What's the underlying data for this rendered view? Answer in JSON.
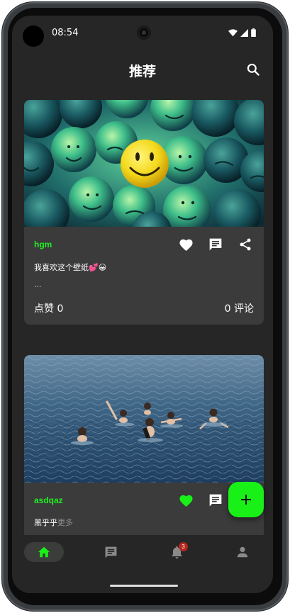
{
  "status_bar": {
    "time": "08:54"
  },
  "app_bar": {
    "title": "推荐",
    "search_icon": "search-icon"
  },
  "posts": [
    {
      "author": "hgm",
      "text": "我喜欢这个壁纸💕😀",
      "ellipsis": "...",
      "likes_label": "点赞 0",
      "comments_label": "0 评论",
      "liked": false,
      "image": "green smiley balls with one yellow smiley"
    },
    {
      "author": "asdqaz",
      "text": "黑乎乎",
      "more": "更多",
      "liked": true,
      "image": "people swimming in the sea"
    }
  ],
  "fab": {
    "icon": "plus-icon"
  },
  "bottom_nav": {
    "items": [
      {
        "icon": "home-icon",
        "active": true
      },
      {
        "icon": "chat-icon",
        "active": false
      },
      {
        "icon": "bell-icon",
        "active": false,
        "badge": "3"
      },
      {
        "icon": "person-icon",
        "active": false
      }
    ]
  },
  "colors": {
    "accent": "#18f018",
    "background": "#262626",
    "card": "#3b3b3b",
    "badge": "#b3261e"
  }
}
